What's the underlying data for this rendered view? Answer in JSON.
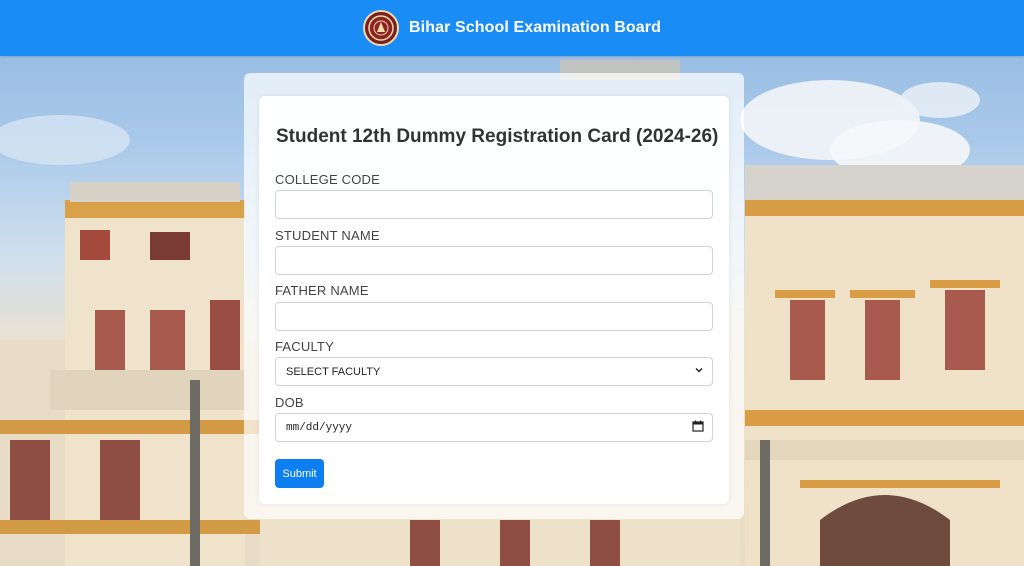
{
  "header": {
    "title": "Bihar School Examination Board",
    "logo_icon": "bseb-emblem-icon",
    "background_color": "#1a8cf5"
  },
  "form": {
    "title": "Student 12th Dummy Registration Card (2024-26)",
    "fields": {
      "college_code": {
        "label": "COLLEGE CODE",
        "value": ""
      },
      "student_name": {
        "label": "STUDENT NAME",
        "value": ""
      },
      "father_name": {
        "label": "FATHER NAME",
        "value": ""
      },
      "faculty": {
        "label": "FACULTY",
        "selected": "SELECT FACULTY",
        "icon": "chevron-down-icon"
      },
      "dob": {
        "label": "DOB",
        "placeholder": "mm/dd/yyyy",
        "icon": "calendar-icon"
      }
    },
    "submit_label": "Submit",
    "accent_color": "#0d7ff2"
  }
}
